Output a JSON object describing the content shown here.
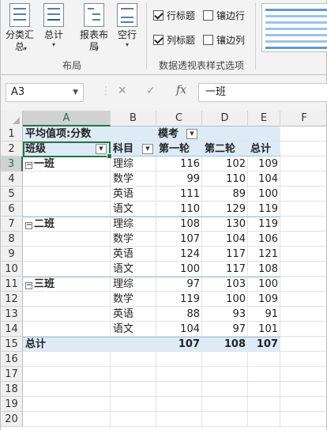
{
  "ribbon": {
    "buttons": [
      {
        "label": "分类汇总",
        "line1": "分类汇",
        "line2": "总"
      },
      {
        "label": "总计",
        "line1": "总计",
        "line2": ""
      },
      {
        "label": "报表布局",
        "line1": "报表布",
        "line2": "局"
      },
      {
        "label": "空行",
        "line1": "空行",
        "line2": ""
      }
    ],
    "layout_group_label": "布局",
    "options": {
      "row_headers": {
        "label": "行标题",
        "checked": true
      },
      "banded_rows": {
        "label": "镶边行",
        "checked": false
      },
      "col_headers": {
        "label": "列标题",
        "checked": true
      },
      "banded_cols": {
        "label": "镶边列",
        "checked": false
      }
    },
    "style_options_group_label": "数据透视表样式选项"
  },
  "formula_bar": {
    "name_box": "A3",
    "fx_label": "fx",
    "cancel_icon": "✕",
    "enter_icon": "✓",
    "content": "一班"
  },
  "sheet": {
    "columns": [
      "A",
      "B",
      "C",
      "D",
      "E",
      "F"
    ],
    "row_numbers": [
      "1",
      "2",
      "3",
      "4",
      "5",
      "6",
      "7",
      "8",
      "9",
      "10",
      "11",
      "12",
      "13",
      "14",
      "15",
      "16",
      "17",
      "18",
      "19",
      "20"
    ],
    "pivot": {
      "value_label": "平均值项:分数",
      "column_field": "模考",
      "row_field": "班级",
      "subject_field": "科目",
      "column_items": [
        "第一轮",
        "第二轮",
        "总计"
      ],
      "groups": [
        {
          "class": "一班",
          "rows": [
            {
              "subject": "理综",
              "values": [
                "116",
                "102",
                "109"
              ]
            },
            {
              "subject": "数学",
              "values": [
                "99",
                "110",
                "104"
              ]
            },
            {
              "subject": "英语",
              "values": [
                "111",
                "89",
                "100"
              ]
            },
            {
              "subject": "语文",
              "values": [
                "110",
                "129",
                "119"
              ]
            }
          ]
        },
        {
          "class": "二班",
          "rows": [
            {
              "subject": "理综",
              "values": [
                "108",
                "130",
                "119"
              ]
            },
            {
              "subject": "数学",
              "values": [
                "107",
                "104",
                "106"
              ]
            },
            {
              "subject": "英语",
              "values": [
                "124",
                "117",
                "121"
              ]
            },
            {
              "subject": "语文",
              "values": [
                "100",
                "117",
                "108"
              ]
            }
          ]
        },
        {
          "class": "三班",
          "rows": [
            {
              "subject": "理综",
              "values": [
                "97",
                "103",
                "100"
              ]
            },
            {
              "subject": "数学",
              "values": [
                "119",
                "100",
                "109"
              ]
            },
            {
              "subject": "英语",
              "values": [
                "88",
                "93",
                "91"
              ]
            },
            {
              "subject": "语文",
              "values": [
                "104",
                "97",
                "101"
              ]
            }
          ]
        }
      ],
      "grand_total": {
        "label": "总计",
        "values": [
          "107",
          "108",
          "107"
        ]
      }
    }
  }
}
